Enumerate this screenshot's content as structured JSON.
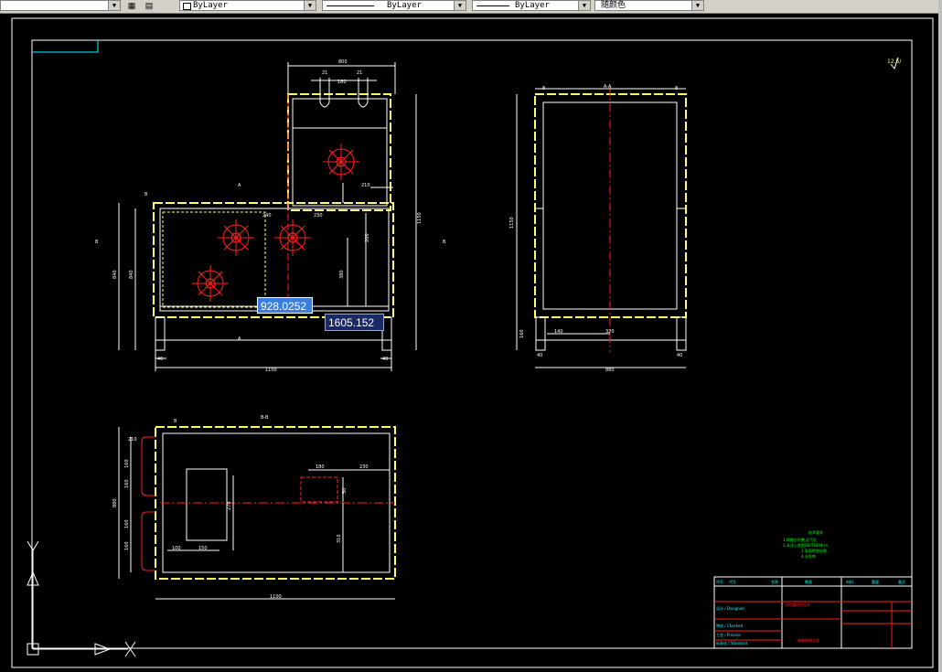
{
  "toolbar": {
    "layer_dropdown": "ByLayer",
    "linetype_dropdown": "ByLayer",
    "lineweight_dropdown": "ByLayer",
    "color_dropdown": "随颜色"
  },
  "dynamic_input": {
    "length_value": "928.0252",
    "angle_value": "1605.152"
  },
  "drawing": {
    "front_view_dims": [
      "800",
      "21",
      "180",
      "21",
      "1150",
      "200",
      "380",
      "840",
      "60",
      "1100",
      "40",
      "40",
      "210",
      "240",
      "230",
      "8",
      "B",
      "A"
    ],
    "side_view_label": "A-A",
    "side_view_dims": [
      "8",
      "8",
      "1150",
      "160",
      "140",
      "320",
      "40",
      "40",
      "880"
    ],
    "plan_view_label": "B-B",
    "plan_view_dims": [
      "210",
      "160",
      "160",
      "160",
      "160",
      "880",
      "100",
      "150",
      "270",
      "180",
      "230",
      "50",
      "310",
      "1100",
      "8"
    ],
    "roughness_mark": "12.5/",
    "notes_title": "技术要求",
    "notes": [
      "1.焊缝应平整,无气孔",
      "2.未注公差按GB/T1804-m",
      "3.表面喷塑处理",
      "4.去毛刺"
    ],
    "title_block": {
      "project_name": "试验箱结构设计",
      "drawing_name": "箱体焊接总图",
      "rows": [
        "设计 / Designed",
        "审核 / Checked",
        "工艺 / Process",
        "标准化 / Standard",
        "批准 / Approved"
      ],
      "header": [
        "序号",
        "代号",
        "名称",
        "数量",
        "材料",
        "重量",
        "备注"
      ]
    }
  },
  "colors": {
    "frame": "#ffffff",
    "yellow": "#ffff66",
    "cyan": "#00ffff",
    "red": "#ff2020",
    "green": "#00ff00",
    "dynamic_blue": "#3a7ee0"
  }
}
